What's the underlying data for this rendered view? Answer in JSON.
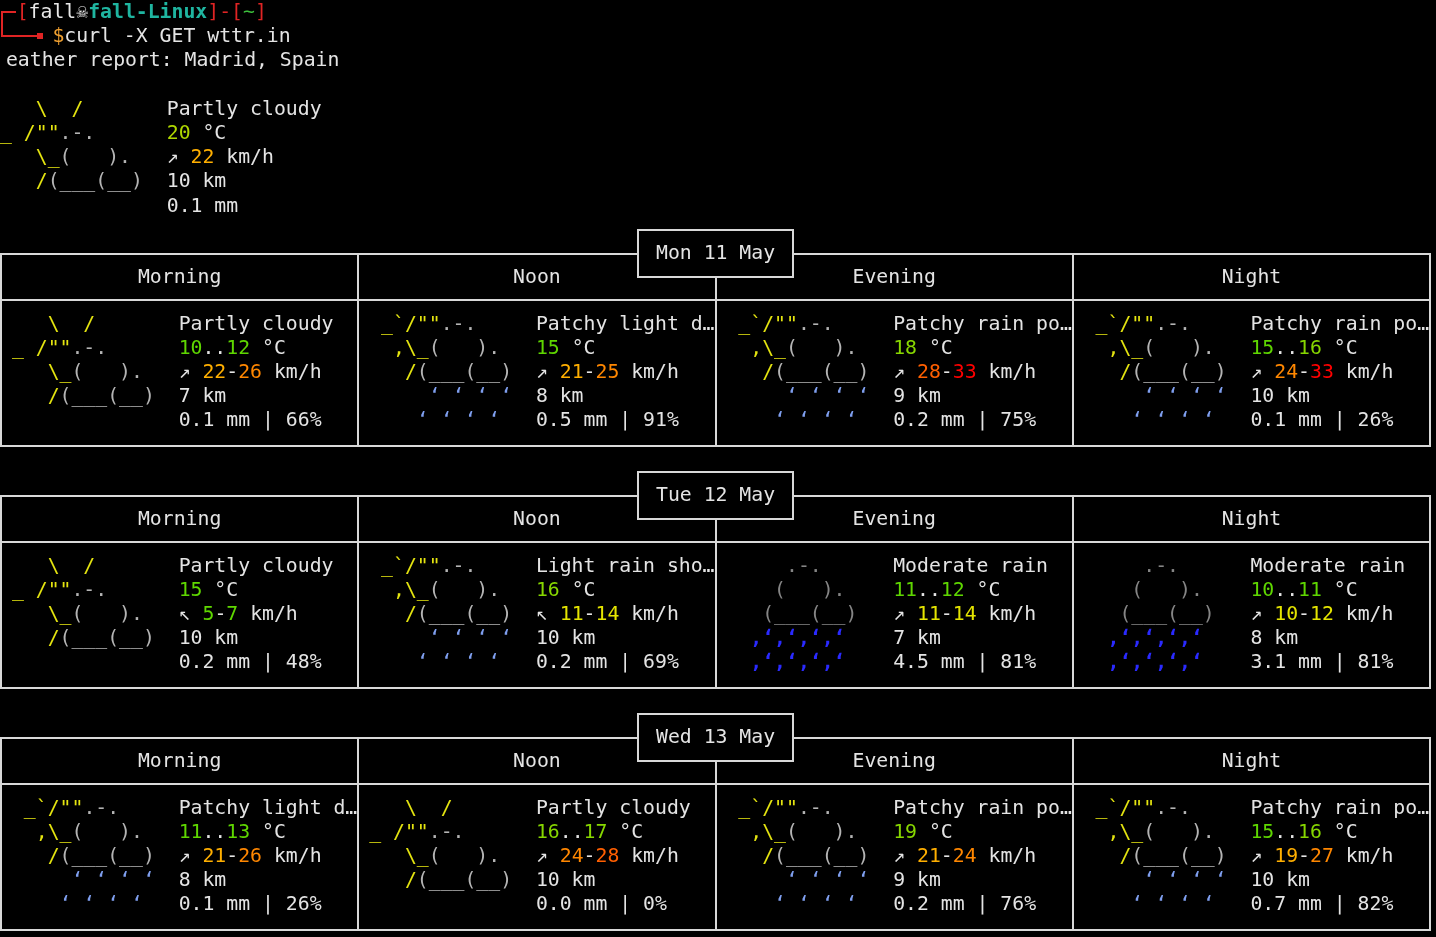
{
  "prompt": {
    "segments": [
      {
        "text": "[",
        "kind": "bracket"
      },
      {
        "text": "fall",
        "kind": "user"
      },
      {
        "text": "☠",
        "kind": "symbol"
      },
      {
        "text": "fall-Linux",
        "kind": "host"
      },
      {
        "text": "]-[",
        "kind": "bracket"
      },
      {
        "text": "~",
        "kind": "path"
      },
      {
        "text": "]",
        "kind": "bracket"
      }
    ],
    "symbol": "$",
    "command": "curl -X GET wttr.in"
  },
  "report_title": "eather report: Madrid, Spain",
  "current": {
    "art": [
      [
        {
          "text": "   \\  /",
          "kind": "sun"
        }
      ],
      [
        {
          "text": "_ /\"\"",
          "kind": "sun"
        },
        {
          "text": ".-.",
          "kind": "cloud"
        }
      ],
      [
        {
          "text": "   \\_",
          "kind": "sun"
        },
        {
          "text": "(   ).",
          "kind": "cloud"
        }
      ],
      [
        {
          "text": "   /",
          "kind": "sun"
        },
        {
          "text": "(___(__)",
          "kind": "cloud"
        }
      ]
    ],
    "condition": "Partly cloudy",
    "temperature": {
      "values": [
        {
          "text": "20",
          "color": "#afd700"
        }
      ],
      "unit": "°C"
    },
    "wind": {
      "arrow": "↗",
      "values": [
        {
          "text": "22",
          "color": "#ffaf00"
        }
      ],
      "unit": "km/h"
    },
    "visibility": "10 km",
    "precipitation": "0.1 mm"
  },
  "days": [
    {
      "date": "Mon 11 May",
      "periods": [
        {
          "label": "Morning",
          "art": [
            [
              {
                "text": "   \\  /",
                "kind": "sun"
              }
            ],
            [
              {
                "text": "_ /\"\"",
                "kind": "sun"
              },
              {
                "text": ".-.",
                "kind": "cloud"
              }
            ],
            [
              {
                "text": "   \\_",
                "kind": "sun"
              },
              {
                "text": "(   ).",
                "kind": "cloud"
              }
            ],
            [
              {
                "text": "   /",
                "kind": "sun"
              },
              {
                "text": "(___(__)",
                "kind": "cloud"
              }
            ]
          ],
          "condition": "Partly cloudy",
          "temperature": {
            "values": [
              {
                "text": "10",
                "color": "#5fd700"
              },
              {
                "text": "12",
                "color": "#5fd700"
              }
            ],
            "separator": "..",
            "unit": "°C"
          },
          "wind": {
            "arrow": "↗",
            "values": [
              {
                "text": "22",
                "color": "#ffaf00"
              },
              {
                "text": "26",
                "color": "#ff8700"
              }
            ],
            "separator": "-",
            "unit": "km/h"
          },
          "visibility": "7 km",
          "precipitation": "0.1 mm | 66%"
        },
        {
          "label": "Noon",
          "art": [
            [
              {
                "text": " _`/\"\"",
                "kind": "sun"
              },
              {
                "text": ".-.",
                "kind": "cloud"
              }
            ],
            [
              {
                "text": "  ,\\_",
                "kind": "sun"
              },
              {
                "text": "(   ).",
                "kind": "cloud"
              }
            ],
            [
              {
                "text": "   /",
                "kind": "sun"
              },
              {
                "text": "(___(__)",
                "kind": "cloud"
              }
            ],
            [
              {
                "text": "     ‘ ‘ ‘ ‘",
                "kind": "drizzle"
              }
            ],
            [
              {
                "text": "    ‘ ‘ ‘ ‘",
                "kind": "drizzle"
              }
            ]
          ],
          "condition": "Patchy light d…",
          "temperature": {
            "values": [
              {
                "text": "15",
                "color": "#5fd700"
              }
            ],
            "unit": "°C"
          },
          "wind": {
            "arrow": "↗",
            "values": [
              {
                "text": "21",
                "color": "#ffaf00"
              },
              {
                "text": "25",
                "color": "#ff8700"
              }
            ],
            "separator": "-",
            "unit": "km/h"
          },
          "visibility": "8 km",
          "precipitation": "0.5 mm | 91%"
        },
        {
          "label": "Evening",
          "art": [
            [
              {
                "text": " _`/\"\"",
                "kind": "sun"
              },
              {
                "text": ".-.",
                "kind": "cloud"
              }
            ],
            [
              {
                "text": "  ,\\_",
                "kind": "sun"
              },
              {
                "text": "(   ).",
                "kind": "cloud"
              }
            ],
            [
              {
                "text": "   /",
                "kind": "sun"
              },
              {
                "text": "(___(__)",
                "kind": "cloud"
              }
            ],
            [
              {
                "text": "     ‘ ‘ ‘ ‘",
                "kind": "drizzle"
              }
            ],
            [
              {
                "text": "    ‘ ‘ ‘ ‘",
                "kind": "drizzle"
              }
            ]
          ],
          "condition": "Patchy rain po…",
          "temperature": {
            "values": [
              {
                "text": "18",
                "color": "#87d700"
              }
            ],
            "unit": "°C"
          },
          "wind": {
            "arrow": "↗",
            "values": [
              {
                "text": "28",
                "color": "#ff5f00"
              },
              {
                "text": "33",
                "color": "#ff0000"
              }
            ],
            "separator": "-",
            "unit": "km/h"
          },
          "visibility": "9 km",
          "precipitation": "0.2 mm | 75%"
        },
        {
          "label": "Night",
          "art": [
            [
              {
                "text": " _`/\"\"",
                "kind": "sun"
              },
              {
                "text": ".-.",
                "kind": "cloud"
              }
            ],
            [
              {
                "text": "  ,\\_",
                "kind": "sun"
              },
              {
                "text": "(   ).",
                "kind": "cloud"
              }
            ],
            [
              {
                "text": "   /",
                "kind": "sun"
              },
              {
                "text": "(___(__)",
                "kind": "cloud"
              }
            ],
            [
              {
                "text": "     ‘ ‘ ‘ ‘",
                "kind": "drizzle"
              }
            ],
            [
              {
                "text": "    ‘ ‘ ‘ ‘",
                "kind": "drizzle"
              }
            ]
          ],
          "condition": "Patchy rain po…",
          "temperature": {
            "values": [
              {
                "text": "15",
                "color": "#5fd700"
              },
              {
                "text": "16",
                "color": "#87d700"
              }
            ],
            "separator": "..",
            "unit": "°C"
          },
          "wind": {
            "arrow": "↗",
            "values": [
              {
                "text": "24",
                "color": "#ff8700"
              },
              {
                "text": "33",
                "color": "#ff0000"
              }
            ],
            "separator": "-",
            "unit": "km/h"
          },
          "visibility": "10 km",
          "precipitation": "0.1 mm | 26%"
        }
      ]
    },
    {
      "date": "Tue 12 May",
      "periods": [
        {
          "label": "Morning",
          "art": [
            [
              {
                "text": "   \\  /",
                "kind": "sun"
              }
            ],
            [
              {
                "text": "_ /\"\"",
                "kind": "sun"
              },
              {
                "text": ".-.",
                "kind": "cloud"
              }
            ],
            [
              {
                "text": "   \\_",
                "kind": "sun"
              },
              {
                "text": "(   ).",
                "kind": "cloud"
              }
            ],
            [
              {
                "text": "   /",
                "kind": "sun"
              },
              {
                "text": "(___(__)",
                "kind": "cloud"
              }
            ]
          ],
          "condition": "Partly cloudy",
          "temperature": {
            "values": [
              {
                "text": "15",
                "color": "#5fd700"
              }
            ],
            "unit": "°C"
          },
          "wind": {
            "arrow": "↖",
            "values": [
              {
                "text": "5",
                "color": "#5fd700"
              },
              {
                "text": "7",
                "color": "#5fd700"
              }
            ],
            "separator": "-",
            "unit": "km/h"
          },
          "visibility": "10 km",
          "precipitation": "0.2 mm | 48%"
        },
        {
          "label": "Noon",
          "art": [
            [
              {
                "text": " _`/\"\"",
                "kind": "sun"
              },
              {
                "text": ".-.",
                "kind": "cloud"
              }
            ],
            [
              {
                "text": "  ,\\_",
                "kind": "sun"
              },
              {
                "text": "(   ).",
                "kind": "cloud"
              }
            ],
            [
              {
                "text": "   /",
                "kind": "sun"
              },
              {
                "text": "(___(__)",
                "kind": "cloud"
              }
            ],
            [
              {
                "text": "     ‘ ‘ ‘ ‘",
                "kind": "drizzle"
              }
            ],
            [
              {
                "text": "    ‘ ‘ ‘ ‘",
                "kind": "drizzle"
              }
            ]
          ],
          "condition": "Light rain sho…",
          "temperature": {
            "values": [
              {
                "text": "16",
                "color": "#87d700"
              }
            ],
            "unit": "°C"
          },
          "wind": {
            "arrow": "↖",
            "values": [
              {
                "text": "11",
                "color": "#e4e400"
              },
              {
                "text": "14",
                "color": "#e4e400"
              }
            ],
            "separator": "-",
            "unit": "km/h"
          },
          "visibility": "10 km",
          "precipitation": "0.2 mm | 69%"
        },
        {
          "label": "Evening",
          "art": [
            [
              {
                "text": "     .-.",
                "kind": "dark_cloud"
              }
            ],
            [
              {
                "text": "    (   ).",
                "kind": "dark_cloud"
              }
            ],
            [
              {
                "text": "   (___(__)",
                "kind": "dark_cloud"
              }
            ],
            [
              {
                "text": "  ‚ʻ‚ʻ‚ʻ‚ʻ",
                "kind": "rain"
              }
            ],
            [
              {
                "text": "  ‚ʻ‚ʻ‚ʻ‚ʻ",
                "kind": "rain"
              }
            ]
          ],
          "condition": "Moderate rain",
          "temperature": {
            "values": [
              {
                "text": "11",
                "color": "#5fd700"
              },
              {
                "text": "12",
                "color": "#5fd700"
              }
            ],
            "separator": "..",
            "unit": "°C"
          },
          "wind": {
            "arrow": "↗",
            "values": [
              {
                "text": "11",
                "color": "#e4e400"
              },
              {
                "text": "14",
                "color": "#e4e400"
              }
            ],
            "separator": "-",
            "unit": "km/h"
          },
          "visibility": "7 km",
          "precipitation": "4.5 mm | 81%"
        },
        {
          "label": "Night",
          "art": [
            [
              {
                "text": "     .-.",
                "kind": "dark_cloud"
              }
            ],
            [
              {
                "text": "    (   ).",
                "kind": "dark_cloud"
              }
            ],
            [
              {
                "text": "   (___(__)",
                "kind": "dark_cloud"
              }
            ],
            [
              {
                "text": "  ‚ʻ‚ʻ‚ʻ‚ʻ",
                "kind": "rain"
              }
            ],
            [
              {
                "text": "  ‚ʻ‚ʻ‚ʻ‚ʻ",
                "kind": "rain"
              }
            ]
          ],
          "condition": "Moderate rain",
          "temperature": {
            "values": [
              {
                "text": "10",
                "color": "#5fd700"
              },
              {
                "text": "11",
                "color": "#5fd700"
              }
            ],
            "separator": "..",
            "unit": "°C"
          },
          "wind": {
            "arrow": "↗",
            "values": [
              {
                "text": "10",
                "color": "#e4e400"
              },
              {
                "text": "12",
                "color": "#e4e400"
              }
            ],
            "separator": "-",
            "unit": "km/h"
          },
          "visibility": "8 km",
          "precipitation": "3.1 mm | 81%"
        }
      ]
    },
    {
      "date": "Wed 13 May",
      "periods": [
        {
          "label": "Morning",
          "art": [
            [
              {
                "text": " _`/\"\"",
                "kind": "sun"
              },
              {
                "text": ".-.",
                "kind": "cloud"
              }
            ],
            [
              {
                "text": "  ,\\_",
                "kind": "sun"
              },
              {
                "text": "(   ).",
                "kind": "cloud"
              }
            ],
            [
              {
                "text": "   /",
                "kind": "sun"
              },
              {
                "text": "(___(__)",
                "kind": "cloud"
              }
            ],
            [
              {
                "text": "     ‘ ‘ ‘ ‘",
                "kind": "drizzle"
              }
            ],
            [
              {
                "text": "    ‘ ‘ ‘ ‘",
                "kind": "drizzle"
              }
            ]
          ],
          "condition": "Patchy light d…",
          "temperature": {
            "values": [
              {
                "text": "11",
                "color": "#5fd700"
              },
              {
                "text": "13",
                "color": "#5fd700"
              }
            ],
            "separator": "..",
            "unit": "°C"
          },
          "wind": {
            "arrow": "↗",
            "values": [
              {
                "text": "21",
                "color": "#ffaf00"
              },
              {
                "text": "26",
                "color": "#ff8700"
              }
            ],
            "separator": "-",
            "unit": "km/h"
          },
          "visibility": "8 km",
          "precipitation": "0.1 mm | 26%"
        },
        {
          "label": "Noon",
          "art": [
            [
              {
                "text": "   \\  /",
                "kind": "sun"
              }
            ],
            [
              {
                "text": "_ /\"\"",
                "kind": "sun"
              },
              {
                "text": ".-.",
                "kind": "cloud"
              }
            ],
            [
              {
                "text": "   \\_",
                "kind": "sun"
              },
              {
                "text": "(   ).",
                "kind": "cloud"
              }
            ],
            [
              {
                "text": "   /",
                "kind": "sun"
              },
              {
                "text": "(___(__)",
                "kind": "cloud"
              }
            ]
          ],
          "condition": "Partly cloudy",
          "temperature": {
            "values": [
              {
                "text": "16",
                "color": "#87d700"
              },
              {
                "text": "17",
                "color": "#87d700"
              }
            ],
            "separator": "..",
            "unit": "°C"
          },
          "wind": {
            "arrow": "↗",
            "values": [
              {
                "text": "24",
                "color": "#ff8700"
              },
              {
                "text": "28",
                "color": "#ff5f00"
              }
            ],
            "separator": "-",
            "unit": "km/h"
          },
          "visibility": "10 km",
          "precipitation": "0.0 mm | 0%"
        },
        {
          "label": "Evening",
          "art": [
            [
              {
                "text": " _`/\"\"",
                "kind": "sun"
              },
              {
                "text": ".-.",
                "kind": "cloud"
              }
            ],
            [
              {
                "text": "  ,\\_",
                "kind": "sun"
              },
              {
                "text": "(   ).",
                "kind": "cloud"
              }
            ],
            [
              {
                "text": "   /",
                "kind": "sun"
              },
              {
                "text": "(___(__)",
                "kind": "cloud"
              }
            ],
            [
              {
                "text": "     ‘ ‘ ‘ ‘",
                "kind": "drizzle"
              }
            ],
            [
              {
                "text": "    ‘ ‘ ‘ ‘",
                "kind": "drizzle"
              }
            ]
          ],
          "condition": "Patchy rain po…",
          "temperature": {
            "values": [
              {
                "text": "19",
                "color": "#87d700"
              }
            ],
            "unit": "°C"
          },
          "wind": {
            "arrow": "↗",
            "values": [
              {
                "text": "21",
                "color": "#ffaf00"
              },
              {
                "text": "24",
                "color": "#ff8700"
              }
            ],
            "separator": "-",
            "unit": "km/h"
          },
          "visibility": "9 km",
          "precipitation": "0.2 mm | 76%"
        },
        {
          "label": "Night",
          "art": [
            [
              {
                "text": " _`/\"\"",
                "kind": "sun"
              },
              {
                "text": ".-.",
                "kind": "cloud"
              }
            ],
            [
              {
                "text": "  ,\\_",
                "kind": "sun"
              },
              {
                "text": "(   ).",
                "kind": "cloud"
              }
            ],
            [
              {
                "text": "   /",
                "kind": "sun"
              },
              {
                "text": "(___(__)",
                "kind": "cloud"
              }
            ],
            [
              {
                "text": "     ‘ ‘ ‘ ‘",
                "kind": "drizzle"
              }
            ],
            [
              {
                "text": "    ‘ ‘ ‘ ‘",
                "kind": "drizzle"
              }
            ]
          ],
          "condition": "Patchy rain po…",
          "temperature": {
            "values": [
              {
                "text": "15",
                "color": "#5fd700"
              },
              {
                "text": "16",
                "color": "#87d700"
              }
            ],
            "separator": "..",
            "unit": "°C"
          },
          "wind": {
            "arrow": "↗",
            "values": [
              {
                "text": "19",
                "color": "#ffaf00"
              },
              {
                "text": "27",
                "color": "#ff8700"
              }
            ],
            "separator": "-",
            "unit": "km/h"
          },
          "visibility": "10 km",
          "precipitation": "0.7 mm | 82%"
        }
      ]
    }
  ]
}
